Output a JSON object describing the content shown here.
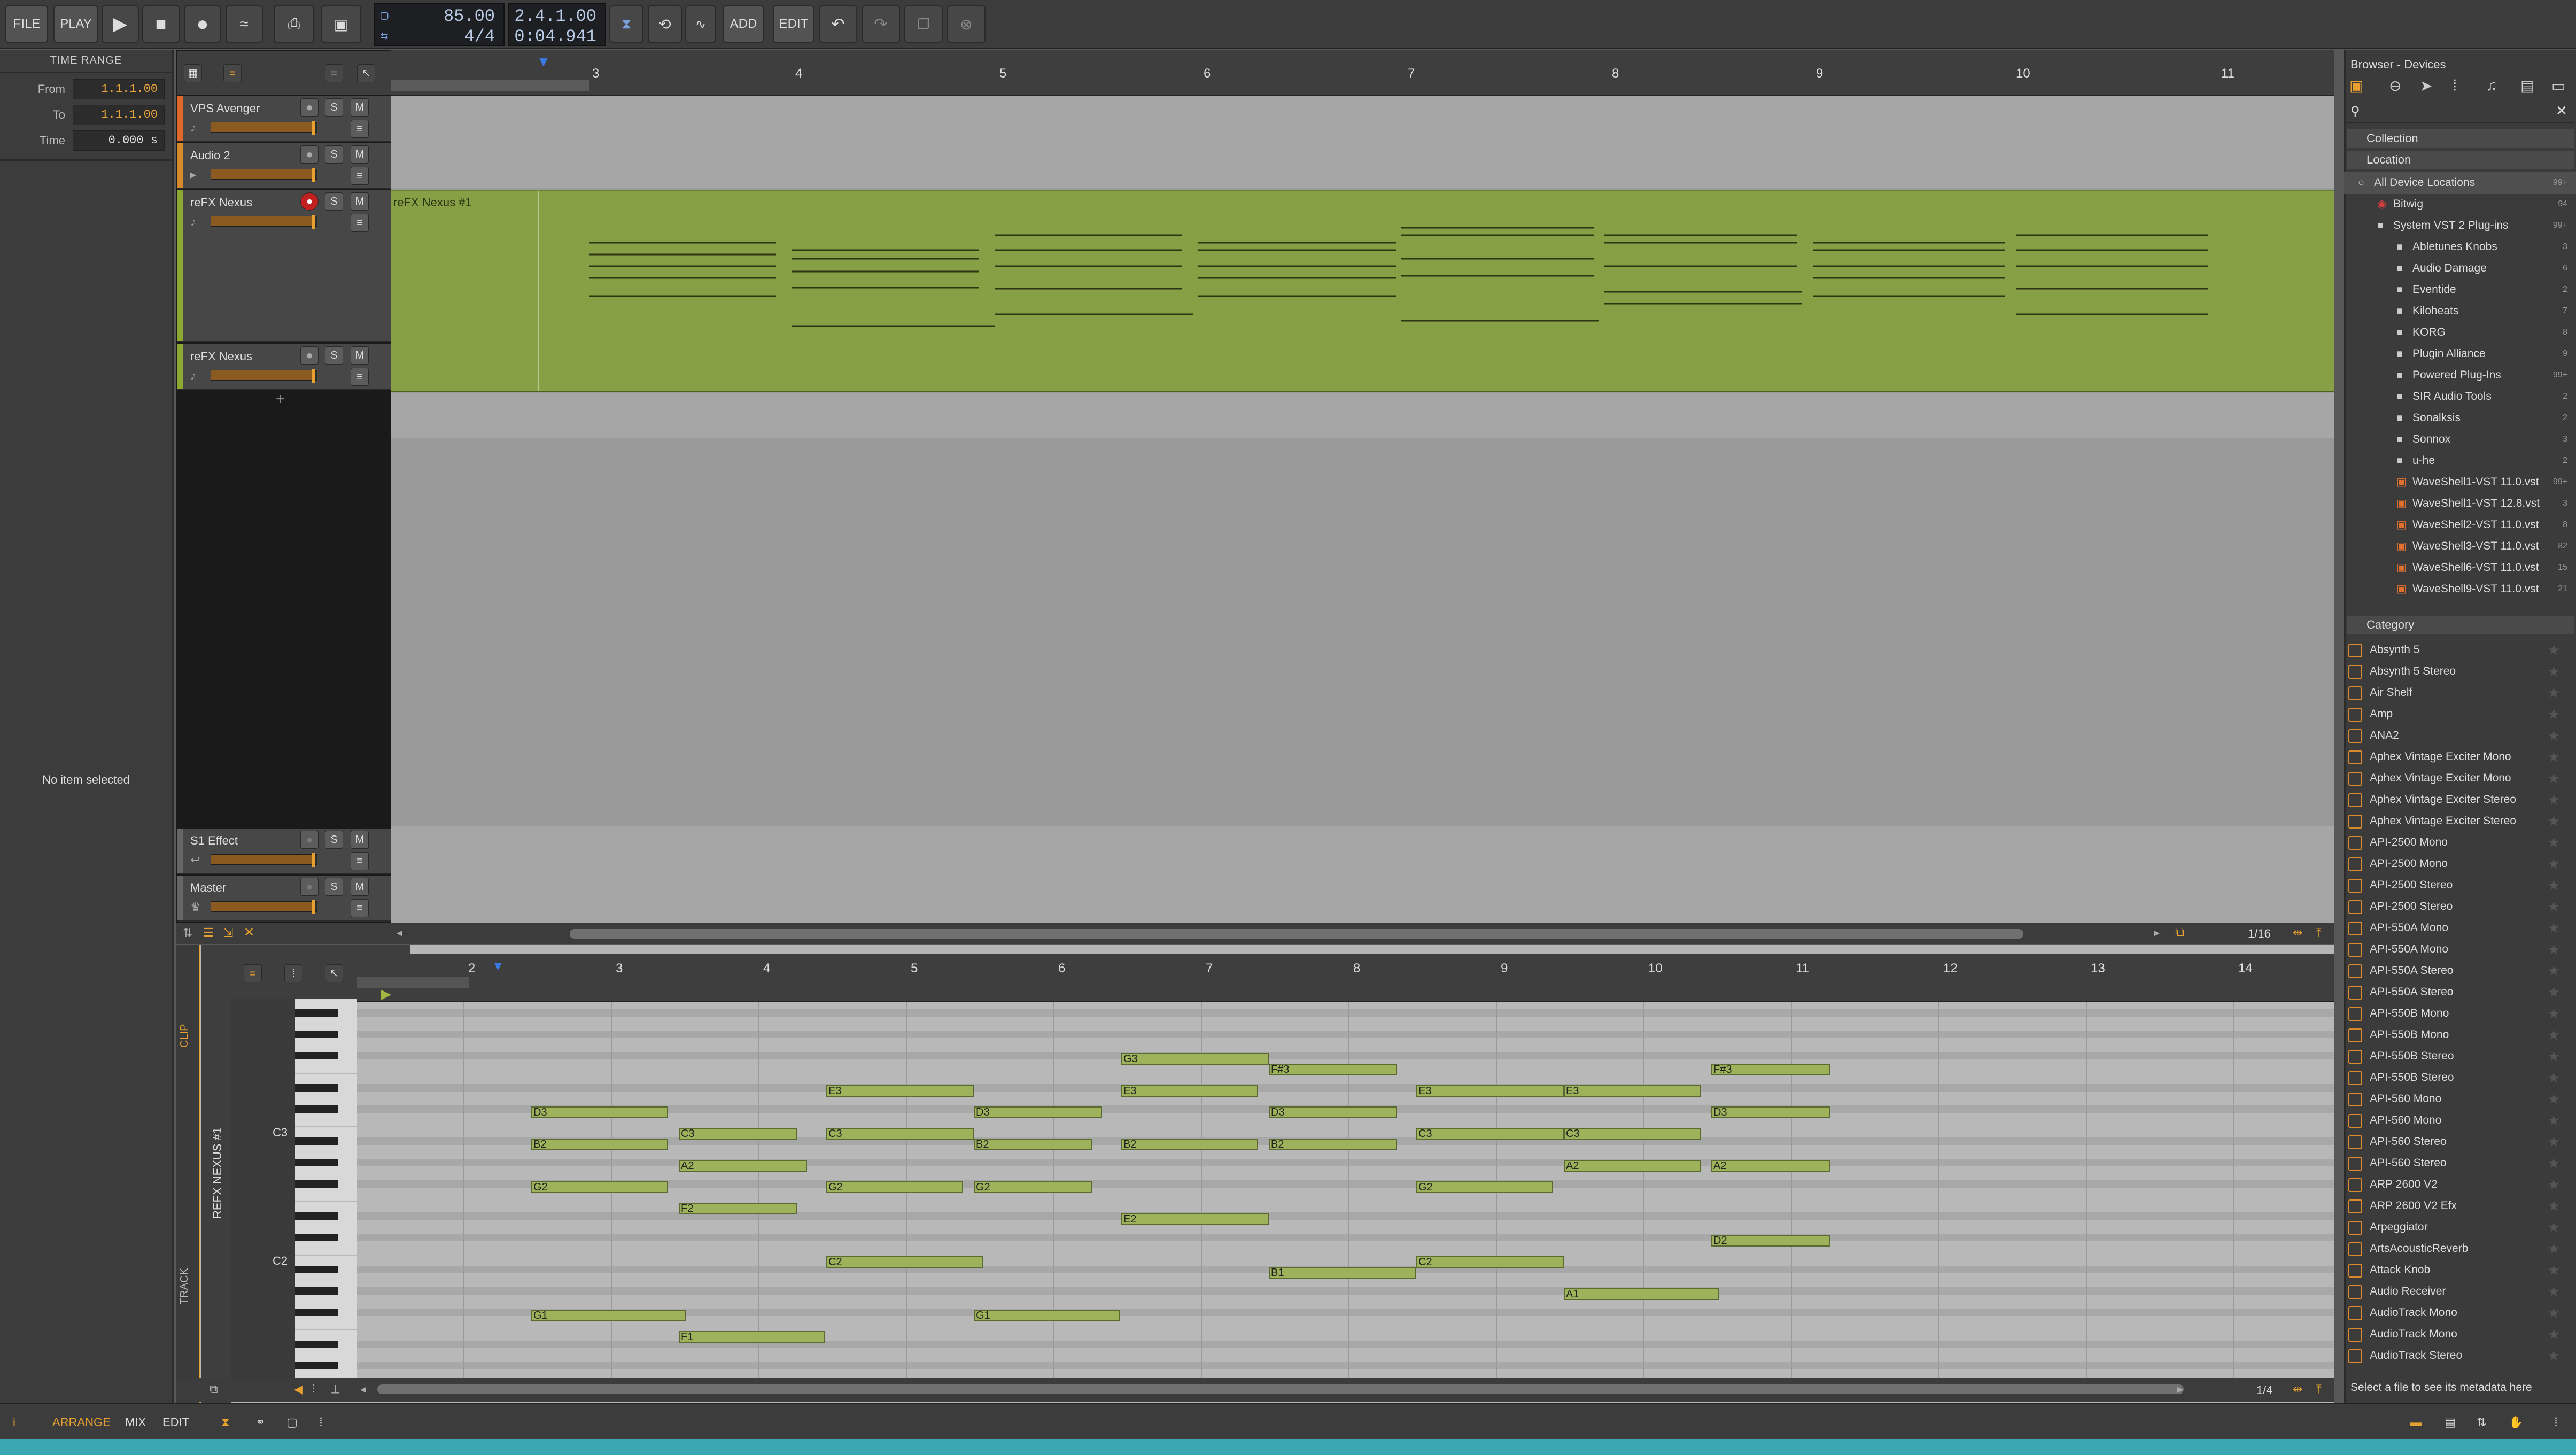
{
  "toolbar": {
    "file": "FILE",
    "play": "PLAY",
    "add": "ADD",
    "edit": "EDIT",
    "tempo": "85.00",
    "time_signature": "4/4",
    "position_beats": "2.4.1.00",
    "position_time": "0:04.941"
  },
  "inspector": {
    "title": "TIME RANGE",
    "from_label": "From",
    "from_value": "1.1.1.00",
    "to_label": "To",
    "to_value": "1.1.1.00",
    "time_label": "Time",
    "time_value": "0.000 s",
    "empty": "No item selected"
  },
  "tracks": [
    {
      "name": "VPS Avenger",
      "color": "#e0672a"
    },
    {
      "name": "Audio 2",
      "color": "#d68a2a"
    },
    {
      "name": "reFX Nexus",
      "color": "#8aa832"
    },
    {
      "name": "reFX Nexus",
      "color": "#8aa832"
    }
  ],
  "effect_tracks": [
    {
      "name": "S1 Effect"
    },
    {
      "name": "Master"
    }
  ],
  "track_buttons": {
    "solo": "S",
    "mute": "M"
  },
  "clip": {
    "name": "reFX Nexus #1"
  },
  "arranger": {
    "ruler": [
      "3",
      "4",
      "5",
      "6",
      "7",
      "8",
      "9",
      "10",
      "11"
    ],
    "grid": "1/16"
  },
  "piano_roll": {
    "clip_tab": "CLIP",
    "track_tab": "TRACK",
    "clip_name": "REFX NEXUS #1",
    "ruler": [
      "2",
      "3",
      "4",
      "5",
      "6",
      "7",
      "8",
      "9",
      "10",
      "11",
      "12",
      "13",
      "14"
    ],
    "key_c3": "C3",
    "key_c2": "C2",
    "grid": "1/4",
    "notes": [
      "G3",
      "F#3",
      "E3",
      "E3",
      "E3",
      "E3",
      "F#3",
      "D3",
      "D3",
      "D3",
      "D3",
      "C3",
      "C3",
      "C3",
      "C3",
      "B2",
      "B2",
      "B2",
      "B2",
      "A2",
      "A2",
      "A2",
      "G2",
      "G2",
      "G2",
      "G2",
      "F2",
      "E2",
      "D2",
      "C2",
      "C2",
      "B1",
      "A1",
      "G1",
      "G1",
      "F1"
    ]
  },
  "browser": {
    "title": "Browser - Devices",
    "sections": {
      "collection": "Collection",
      "location": "Location",
      "category": "Category"
    },
    "locations": [
      {
        "name": "All Device Locations",
        "count": "99+"
      },
      {
        "name": "Bitwig",
        "count": "94"
      },
      {
        "name": "System VST 2 Plug-ins",
        "count": "99+"
      },
      {
        "name": "Abletunes Knobs",
        "count": "3"
      },
      {
        "name": "Audio Damage",
        "count": "6"
      },
      {
        "name": "Eventide",
        "count": "2"
      },
      {
        "name": "Kiloheats",
        "count": "7"
      },
      {
        "name": "KORG",
        "count": "8"
      },
      {
        "name": "Plugin Alliance",
        "count": "9"
      },
      {
        "name": "Powered Plug-Ins",
        "count": "99+"
      },
      {
        "name": "SIR Audio Tools",
        "count": "2"
      },
      {
        "name": "Sonalksis",
        "count": "2"
      },
      {
        "name": "Sonnox",
        "count": "3"
      },
      {
        "name": "u-he",
        "count": "2"
      },
      {
        "name": "WaveShell1-VST 11.0.vst",
        "count": "99+"
      },
      {
        "name": "WaveShell1-VST 12.8.vst",
        "count": "3"
      },
      {
        "name": "WaveShell2-VST 11.0.vst",
        "count": "8"
      },
      {
        "name": "WaveShell3-VST 11.0.vst",
        "count": "82"
      },
      {
        "name": "WaveShell6-VST 11.0.vst",
        "count": "15"
      },
      {
        "name": "WaveShell9-VST 11.0.vst",
        "count": "21"
      }
    ],
    "categories": [
      "Absynth 5",
      "Absynth 5 Stereo",
      "Air Shelf",
      "Amp",
      "ANA2",
      "Aphex Vintage Exciter Mono",
      "Aphex Vintage Exciter Mono",
      "Aphex Vintage Exciter Stereo",
      "Aphex Vintage Exciter Stereo",
      "API-2500 Mono",
      "API-2500 Mono",
      "API-2500 Stereo",
      "API-2500 Stereo",
      "API-550A Mono",
      "API-550A Mono",
      "API-550A Stereo",
      "API-550A Stereo",
      "API-550B Mono",
      "API-550B Mono",
      "API-550B Stereo",
      "API-550B Stereo",
      "API-560 Mono",
      "API-560 Mono",
      "API-560 Stereo",
      "API-560 Stereo",
      "ARP 2600 V2",
      "ARP 2600 V2 Efx",
      "Arpeggiator",
      "ArtsAcousticReverb",
      "Attack Knob",
      "Audio Receiver",
      "AudioTrack Mono",
      "AudioTrack Mono",
      "AudioTrack Stereo"
    ],
    "metadata_hint": "Select a file to see its metadata here"
  },
  "bottom": {
    "arrange": "ARRANGE",
    "mix": "MIX",
    "edit": "EDIT"
  },
  "colors": {
    "accent": "#e8a030",
    "clip_green": "#8aa832",
    "record": "#c02020"
  }
}
